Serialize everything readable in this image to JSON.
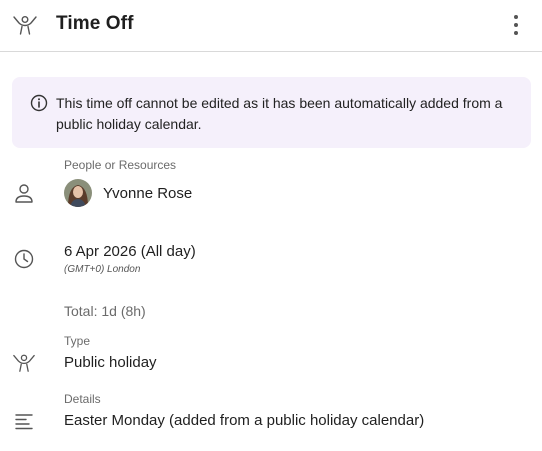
{
  "header": {
    "title": "Time Off",
    "type_icon": "holiday-person-icon",
    "menu_icon": "more-vertical-icon"
  },
  "notice": {
    "icon": "info-icon",
    "text": "This time off cannot be edited as it has been automatically added from a public holiday calendar."
  },
  "people": {
    "label": "People or Resources",
    "icon": "person-icon",
    "person_name": "Yvonne Rose",
    "avatar": "avatar-photo"
  },
  "date": {
    "icon": "clock-icon",
    "value": "6 Apr 2026 (All day)",
    "timezone": "(GMT+0) London",
    "total": "Total: 1d (8h)"
  },
  "type": {
    "icon": "holiday-person-icon",
    "label": "Type",
    "value": "Public holiday"
  },
  "details": {
    "icon": "text-lines-icon",
    "label": "Details",
    "value": "Easter Monday (added from a public holiday calendar)"
  },
  "colors": {
    "notice_background": "#f5f0fb",
    "divider": "#d9d9d9",
    "muted_text": "#6b6b6b"
  }
}
